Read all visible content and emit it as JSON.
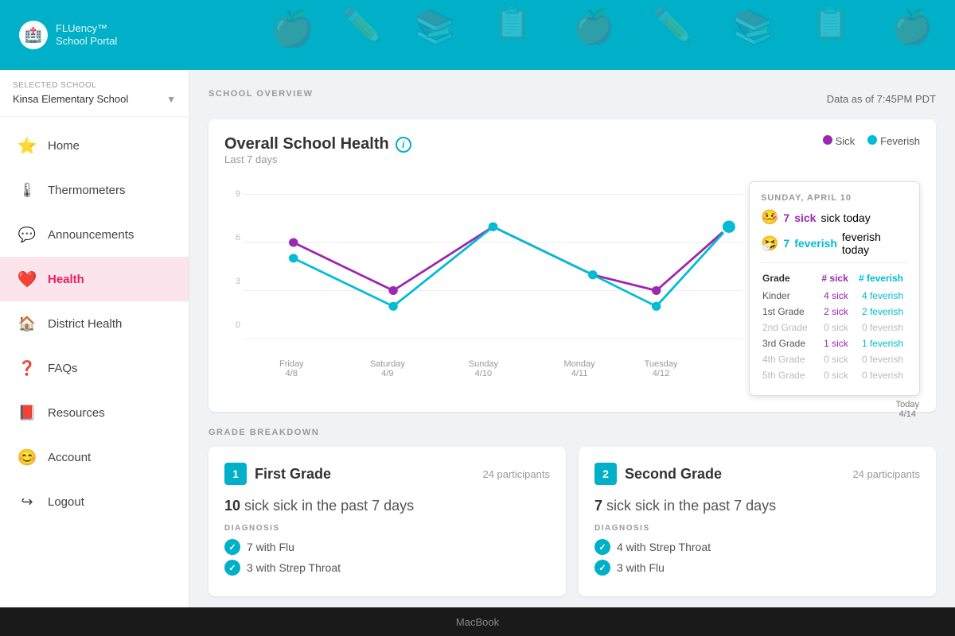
{
  "header": {
    "logo_icon": "🏥",
    "title_line1": "FLUency™",
    "title_line2": "School Portal"
  },
  "sidebar": {
    "school_selector_label": "Selected School",
    "school_name": "Kinsa Elementary School",
    "nav_items": [
      {
        "id": "home",
        "label": "Home",
        "icon": "⭐",
        "active": false
      },
      {
        "id": "thermometers",
        "label": "Thermometers",
        "icon": "🌡",
        "active": false
      },
      {
        "id": "announcements",
        "label": "Announcements",
        "icon": "💬",
        "active": false
      },
      {
        "id": "health",
        "label": "Health",
        "icon": "❤️",
        "active": true
      },
      {
        "id": "district-health",
        "label": "District Health",
        "icon": "🏠",
        "active": false
      },
      {
        "id": "faqs",
        "label": "FAQs",
        "icon": "❓",
        "active": false
      },
      {
        "id": "resources",
        "label": "Resources",
        "icon": "📕",
        "active": false
      },
      {
        "id": "account",
        "label": "Account",
        "icon": "😊",
        "active": false
      },
      {
        "id": "logout",
        "label": "Logout",
        "icon": "↪",
        "active": false
      }
    ]
  },
  "overview": {
    "section_label": "SCHOOL OVERVIEW",
    "timestamp": "Data as of 7:45PM PDT",
    "chart_title": "Overall School Health",
    "chart_subtitle": "Last 7 days",
    "legend_sick": "Sick",
    "legend_feverish": "Feverish",
    "tooltip": {
      "date": "SUNDAY, APRIL 10",
      "sick_count": "7",
      "sick_label": "sick today",
      "feverish_count": "7",
      "feverish_label": "feverish today",
      "table_headers": [
        "Grade",
        "# sick",
        "# feverish"
      ],
      "rows": [
        {
          "grade": "Kinder",
          "sick": "4 sick",
          "feverish": "4 feverish",
          "active": true
        },
        {
          "grade": "1st Grade",
          "sick": "2 sick",
          "feverish": "2 feverish",
          "active": true
        },
        {
          "grade": "2nd Grade",
          "sick": "0 sick",
          "feverish": "0 feverish",
          "active": false
        },
        {
          "grade": "3rd Grade",
          "sick": "1 sick",
          "feverish": "1 feverish",
          "active": true
        },
        {
          "grade": "4th Grade",
          "sick": "0 sick",
          "feverish": "0 feverish",
          "active": false
        },
        {
          "grade": "5th Grade",
          "sick": "0 sick",
          "feverish": "0 feverish",
          "active": false
        }
      ]
    },
    "x_labels": [
      {
        "day": "Friday",
        "date": "4/8"
      },
      {
        "day": "Saturday",
        "date": "4/9"
      },
      {
        "day": "Sunday",
        "date": "4/10"
      },
      {
        "day": "Monday",
        "date": "4/11"
      },
      {
        "day": "Tuesday",
        "date": "4/12"
      },
      {
        "day": "Today",
        "date": "4/14"
      }
    ],
    "today_label": "Today\n4/14"
  },
  "grade_breakdown": {
    "section_label": "GRADE BREAKDOWN",
    "grades": [
      {
        "number": "1",
        "name": "First Grade",
        "participants": "24 participants",
        "sick_count": "10",
        "sick_label": "sick in the past 7 days",
        "diagnosis_label": "DIAGNOSIS",
        "diagnoses": [
          "7 with Flu",
          "3 with Strep Throat"
        ]
      },
      {
        "number": "2",
        "name": "Second Grade",
        "participants": "24 participants",
        "sick_count": "7",
        "sick_label": "sick in the past 7 days",
        "diagnosis_label": "DIAGNOSIS",
        "diagnoses": [
          "4 with Strep Throat",
          "3 with Flu"
        ]
      }
    ]
  },
  "macbook_label": "MacBook"
}
